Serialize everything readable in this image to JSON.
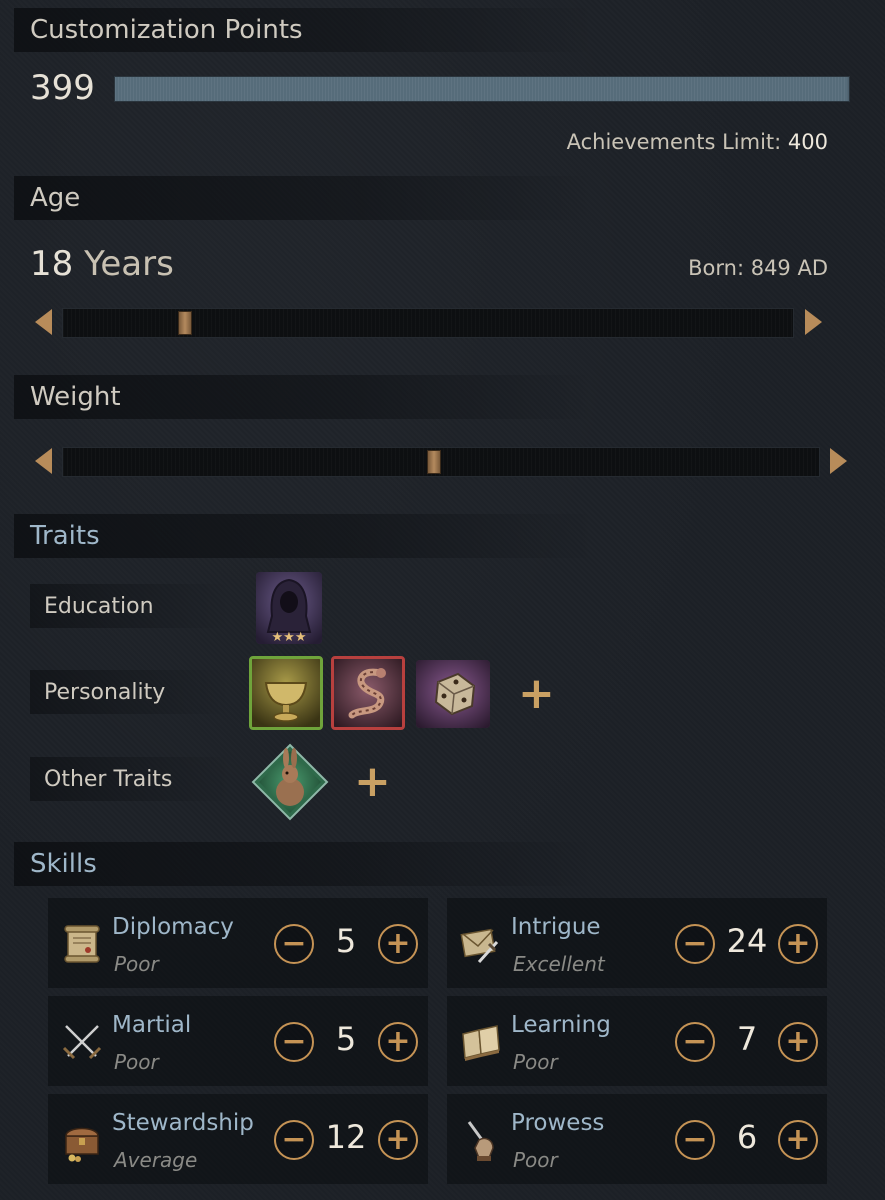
{
  "customization": {
    "title": "Customization Points",
    "points": "399",
    "points_fraction": 0.9975,
    "achievements_label": "Achievements Limit:",
    "achievements_value": "400"
  },
  "age": {
    "title": "Age",
    "number": "18",
    "unit": "Years",
    "born": "Born: 849 AD",
    "slider_fraction": 0.16
  },
  "weight": {
    "title": "Weight",
    "slider_fraction": 0.49
  },
  "traits": {
    "title": "Traits",
    "rows": [
      {
        "label": "Education",
        "icons": [
          "hooded-scholar-icon"
        ]
      },
      {
        "label": "Personality",
        "icons": [
          "chalice-icon",
          "serpent-icon",
          "dice-icon"
        ],
        "add": "+"
      },
      {
        "label": "Other Traits",
        "icons": [
          "rabbit-icon"
        ],
        "add": "+"
      }
    ]
  },
  "skills": {
    "title": "Skills",
    "items": [
      {
        "name": "Diplomacy",
        "level": "Poor",
        "value": "5",
        "icon": "scroll-icon"
      },
      {
        "name": "Intrigue",
        "level": "Excellent",
        "value": "24",
        "icon": "dagger-letter-icon"
      },
      {
        "name": "Martial",
        "level": "Poor",
        "value": "5",
        "icon": "crossed-swords-icon"
      },
      {
        "name": "Learning",
        "level": "Poor",
        "value": "7",
        "icon": "book-icon"
      },
      {
        "name": "Stewardship",
        "level": "Average",
        "value": "12",
        "icon": "treasure-chest-icon"
      },
      {
        "name": "Prowess",
        "level": "Poor",
        "value": "6",
        "icon": "gauntlet-icon"
      }
    ],
    "minus": "−",
    "plus": "+"
  },
  "colors": {
    "accent": "#c59355",
    "skill_name": "#9fb7c9",
    "points_bar": "#566c7a"
  }
}
